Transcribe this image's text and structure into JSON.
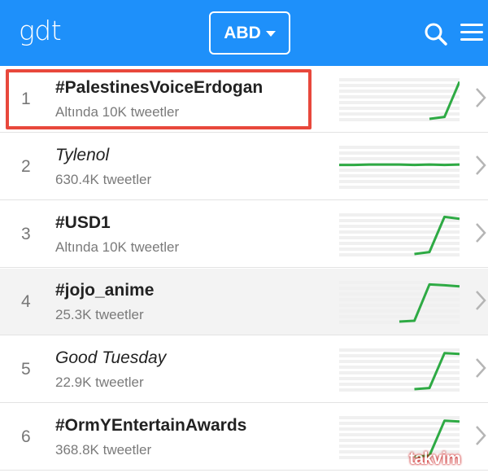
{
  "header": {
    "logo": "gdt",
    "country": "ABD",
    "accent": "#1e90fa"
  },
  "trends": [
    {
      "rank": "1",
      "title": "#PalestinesVoiceErdogan",
      "italic": false,
      "count": "Altında 10K tweetler",
      "trend_series": [
        0,
        0,
        0,
        0,
        0,
        0,
        0,
        0.05,
        0.95
      ]
    },
    {
      "rank": "2",
      "title": "Tylenol",
      "italic": true,
      "count": "630.4K tweetler",
      "trend_series": [
        0.55,
        0.55,
        0.56,
        0.56,
        0.56,
        0.55,
        0.56,
        0.55,
        0.56
      ]
    },
    {
      "rank": "3",
      "title": "#USD1",
      "italic": false,
      "count": "Altında 10K tweetler",
      "trend_series": [
        0,
        0,
        0,
        0,
        0,
        0,
        0.05,
        0.95,
        0.9
      ]
    },
    {
      "rank": "4",
      "title": "#jojo_anime",
      "italic": false,
      "count": "25.3K tweetler",
      "trend_series": [
        0,
        0,
        0,
        0,
        0,
        0.02,
        0.95,
        0.93,
        0.9
      ]
    },
    {
      "rank": "5",
      "title": "Good Tuesday",
      "italic": true,
      "count": "22.9K tweetler",
      "trend_series": [
        0,
        0,
        0,
        0,
        0,
        0,
        0.03,
        0.92,
        0.9
      ]
    },
    {
      "rank": "6",
      "title": "#OrmYEntertainAwards",
      "italic": false,
      "count": "368.8K tweetler",
      "trend_series": [
        0,
        0,
        0,
        0,
        0,
        0,
        0.03,
        0.92,
        0.9
      ]
    }
  ],
  "colors": {
    "spark": "#2eaa44",
    "selection": "#e8483c"
  },
  "watermark": "takvim"
}
